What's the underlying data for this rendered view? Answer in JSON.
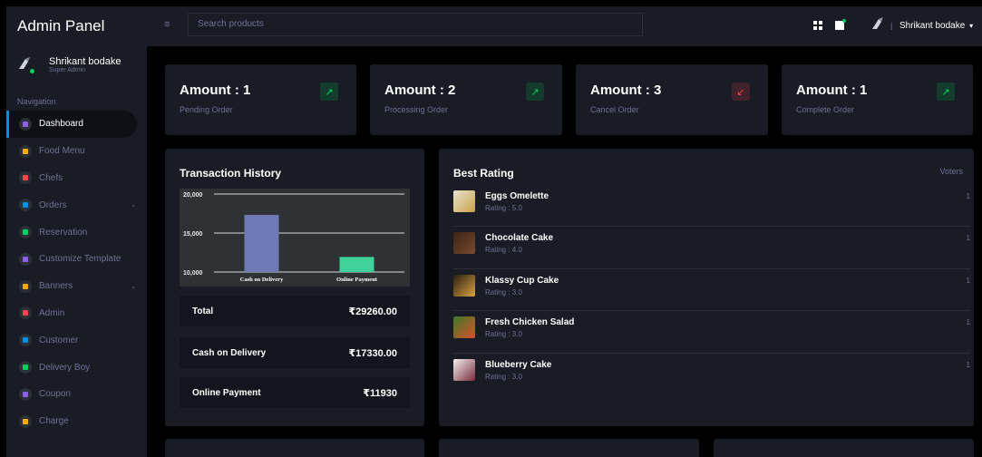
{
  "header": {
    "brand": "Admin Panel",
    "search_placeholder": "Search products",
    "user_name": "Shrikant bodake",
    "separator": "|",
    "caret": "▾"
  },
  "sidebar": {
    "profile_name": "Shrikant bodake",
    "profile_role": "Super Admin",
    "nav_heading": "Navigation",
    "items": [
      {
        "label": "Dashboard",
        "color": "#8f5fe8",
        "active": true
      },
      {
        "label": "Food Menu",
        "color": "#ffab00"
      },
      {
        "label": "Chefs",
        "color": "#fc424a"
      },
      {
        "label": "Orders",
        "color": "#0090e7",
        "has_chevron": true
      },
      {
        "label": "Reservation",
        "color": "#00d25b"
      },
      {
        "label": "Customize Template",
        "color": "#8f5fe8"
      },
      {
        "label": "Banners",
        "color": "#ffab00",
        "has_chevron": true
      },
      {
        "label": "Admin",
        "color": "#fc424a"
      },
      {
        "label": "Customer",
        "color": "#0090e7"
      },
      {
        "label": "Delivery Boy",
        "color": "#00d25b"
      },
      {
        "label": "Coupon",
        "color": "#8f5fe8"
      },
      {
        "label": "Charge",
        "color": "#ffab00"
      }
    ]
  },
  "stats": [
    {
      "title": "Amount : 1",
      "subtitle": "Pending Order",
      "trend": "up",
      "arrow": "↗"
    },
    {
      "title": "Amount : 2",
      "subtitle": "Processing Order",
      "trend": "up",
      "arrow": "↗"
    },
    {
      "title": "Amount : 3",
      "subtitle": "Cancel Order",
      "trend": "down",
      "arrow": "↙"
    },
    {
      "title": "Amount : 1",
      "subtitle": "Complete Order",
      "trend": "up",
      "arrow": "↗"
    }
  ],
  "transaction": {
    "title": "Transaction History",
    "rows": [
      {
        "label": "Total",
        "amount": "₹29260.00"
      },
      {
        "label": "Cash on Delivery",
        "amount": "₹17330.00"
      },
      {
        "label": "Online Payment",
        "amount": "₹11930"
      }
    ]
  },
  "chart_data": {
    "type": "bar",
    "categories": [
      "Cash on Delivery",
      "Online Payment"
    ],
    "values": [
      17330,
      11930
    ],
    "colors": [
      "#6e7ab5",
      "#3ed19a"
    ],
    "ylim": [
      10000,
      20000
    ],
    "yticks": [
      "10,000",
      "15,000",
      "20,000"
    ],
    "title": "",
    "xlabel": "",
    "ylabel": ""
  },
  "rating": {
    "title": "Best Rating",
    "voters_label": "Voters",
    "items": [
      {
        "name": "Eggs Omelette",
        "rating": "Rating : 5.0",
        "votes": "1"
      },
      {
        "name": "Chocolate Cake",
        "rating": "Rating : 4.0",
        "votes": "1"
      },
      {
        "name": "Klassy Cup Cake",
        "rating": "Rating : 3.0",
        "votes": "1"
      },
      {
        "name": "Fresh Chicken Salad",
        "rating": "Rating : 3.0",
        "votes": "1"
      },
      {
        "name": "Blueberry Cake",
        "rating": "Rating : 3.0",
        "votes": "1"
      }
    ]
  },
  "colors": {
    "background": "#000000",
    "card": "#191c24",
    "muted": "#6c7293",
    "success": "#00d25b",
    "danger": "#fc424a"
  }
}
